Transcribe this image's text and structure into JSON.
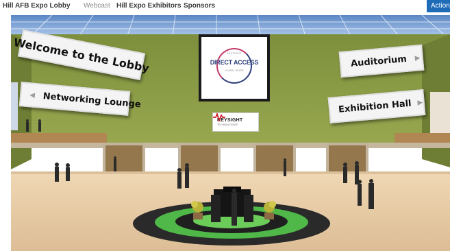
{
  "nav": {
    "links": [
      {
        "label": "Hill AFB Expo Lobby"
      },
      {
        "label": "Webcast"
      },
      {
        "label": "Hill Expo Exhibitors"
      },
      {
        "label": "Sponsors"
      }
    ],
    "actions_label": "Actions"
  },
  "lobby": {
    "welcome_sign": "Welcome to the Lobby",
    "networking_sign": "Networking Lounge",
    "auditorium_sign": "Auditorium",
    "exhibition_sign": "Exhibition Hall"
  },
  "sponsor_panel": {
    "top_text": "KEYSIGHT",
    "title_line1": "DIRECT ACCESS",
    "sub_text": "LEARN MORE"
  },
  "keysight_logo": {
    "name": "KEYSIGHT",
    "sub": "TECHNOLOGIES"
  },
  "colors": {
    "accent": "#1e6bb8",
    "wall": "#8a9a44",
    "floor": "#e8cda8",
    "platform_green": "#4fb848",
    "platform_dark": "#2a2a2a"
  }
}
